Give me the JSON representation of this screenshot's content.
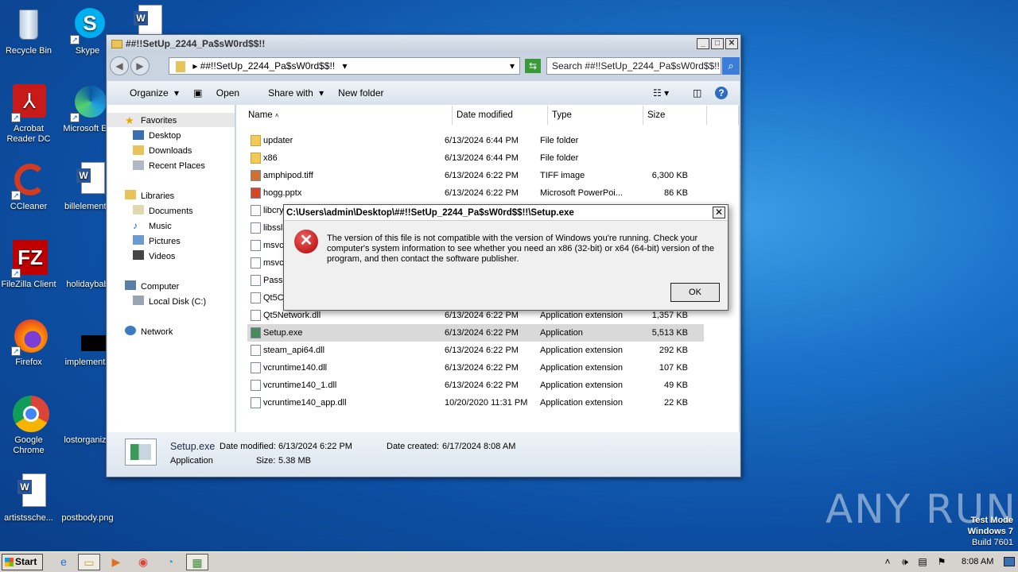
{
  "desktop_icons": [
    {
      "label": "Recycle Bin",
      "icon": "recycle-bin-icon"
    },
    {
      "label": "Skype",
      "icon": "skype-icon"
    },
    {
      "label": "Acrobat Reader DC",
      "icon": "acrobat-icon"
    },
    {
      "label": "Microsoft Ed",
      "icon": "edge-icon"
    },
    {
      "label": "CCleaner",
      "icon": "ccleaner-icon"
    },
    {
      "label": "billelements",
      "icon": "word-doc-icon"
    },
    {
      "label": "FileZilla Client",
      "icon": "filezilla-icon"
    },
    {
      "label": "holidaybab",
      "icon": "blank-file-icon"
    },
    {
      "label": "Firefox",
      "icon": "firefox-icon"
    },
    {
      "label": "implementa",
      "icon": "black-file-icon"
    },
    {
      "label": "Google Chrome",
      "icon": "chrome-icon"
    },
    {
      "label": "lostorganiza",
      "icon": "blank-file-icon"
    },
    {
      "label": "artistssche...",
      "icon": "word-doc-icon"
    },
    {
      "label": "postbody.png",
      "icon": "image-file-icon"
    }
  ],
  "explorer": {
    "title": "##!!SetUp_2244_Pa$sW0rd$$!!",
    "address": "##!!SetUp_2244_Pa$sW0rd$$!!",
    "search_placeholder": "Search ##!!SetUp_2244_Pa$sW0rd$$!!",
    "toolbar": {
      "organize": "Organize",
      "open": "Open",
      "share_with": "Share with",
      "new_folder": "New folder"
    },
    "nav": {
      "favorites": "Favorites",
      "fav_items": [
        "Desktop",
        "Downloads",
        "Recent Places"
      ],
      "libraries": "Libraries",
      "lib_items": [
        "Documents",
        "Music",
        "Pictures",
        "Videos"
      ],
      "computer": "Computer",
      "computer_items": [
        "Local Disk (C:)"
      ],
      "network": "Network"
    },
    "columns": {
      "name": "Name",
      "date": "Date modified",
      "type": "Type",
      "size": "Size"
    },
    "files": [
      {
        "name": "updater",
        "date": "6/13/2024 6:44 PM",
        "type": "File folder",
        "size": ""
      },
      {
        "name": "x86",
        "date": "6/13/2024 6:44 PM",
        "type": "File folder",
        "size": ""
      },
      {
        "name": "amphipod.tiff",
        "date": "6/13/2024 6:22 PM",
        "type": "TIFF image",
        "size": "6,300 KB"
      },
      {
        "name": "hogg.pptx",
        "date": "6/13/2024 6:22 PM",
        "type": "Microsoft PowerPoi...",
        "size": "86 KB"
      },
      {
        "name": "libcry",
        "date": "",
        "type": "",
        "size": ""
      },
      {
        "name": "libssl",
        "date": "",
        "type": "",
        "size": ""
      },
      {
        "name": "msvc",
        "date": "",
        "type": "",
        "size": ""
      },
      {
        "name": "msvc",
        "date": "",
        "type": "",
        "size": ""
      },
      {
        "name": "Pass",
        "date": "",
        "type": "",
        "size": ""
      },
      {
        "name": "Qt5C",
        "date": "",
        "type": "",
        "size": ""
      },
      {
        "name": "Qt5Network.dll",
        "date": "6/13/2024 6:22 PM",
        "type": "Application extension",
        "size": "1,357 KB"
      },
      {
        "name": "Setup.exe",
        "date": "6/13/2024 6:22 PM",
        "type": "Application",
        "size": "5,513 KB"
      },
      {
        "name": "steam_api64.dll",
        "date": "6/13/2024 6:22 PM",
        "type": "Application extension",
        "size": "292 KB"
      },
      {
        "name": "vcruntime140.dll",
        "date": "6/13/2024 6:22 PM",
        "type": "Application extension",
        "size": "107 KB"
      },
      {
        "name": "vcruntime140_1.dll",
        "date": "6/13/2024 6:22 PM",
        "type": "Application extension",
        "size": "49 KB"
      },
      {
        "name": "vcruntime140_app.dll",
        "date": "10/20/2020 11:31 PM",
        "type": "Application extension",
        "size": "22 KB"
      }
    ],
    "details": {
      "name": "Setup.exe",
      "modified_label": "Date modified:",
      "modified": "6/13/2024 6:22 PM",
      "created_label": "Date created:",
      "created": "6/17/2024 8:08 AM",
      "type": "Application",
      "size_label": "Size:",
      "size": "5.38 MB"
    }
  },
  "dialog": {
    "title": "C:\\Users\\admin\\Desktop\\##!!SetUp_2244_Pa$sW0rd$$!!\\Setup.exe",
    "message": "The version of this file is not compatible with the version of Windows you're running. Check your computer's system information to see whether you need an x86 (32-bit) or x64 (64-bit) version of the program, and then contact the software publisher.",
    "ok": "OK"
  },
  "taskbar": {
    "start": "Start",
    "clock": "8:08 AM"
  },
  "watermark": {
    "anyrun": "ANY RUN",
    "test_mode": "Test Mode",
    "os": "Windows 7",
    "build": "Build 7601"
  }
}
